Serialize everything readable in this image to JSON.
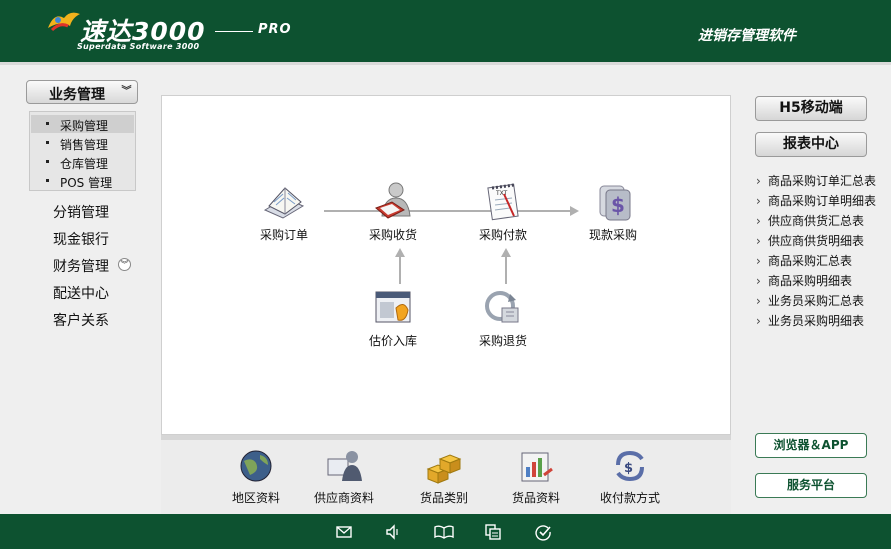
{
  "header": {
    "brand_title": "速达3000",
    "brand_sub": "Superdata Software 3000",
    "brand_pro": "PRO",
    "right_title": "进销存管理软件"
  },
  "sidebar": {
    "menu_label": "业务管理",
    "submenu": [
      {
        "label": "采购管理",
        "selected": true
      },
      {
        "label": "销售管理",
        "selected": false
      },
      {
        "label": "仓库管理",
        "selected": false
      },
      {
        "label": "POS 管理",
        "selected": false
      }
    ],
    "items": [
      "分销管理",
      "现金银行",
      "财务管理",
      "配送中心",
      "客户关系"
    ]
  },
  "flow": {
    "nodes": [
      "采购订单",
      "采购收货",
      "采购付款",
      "现款采购",
      "估价入库",
      "采购退货"
    ]
  },
  "tools": [
    "地区资料",
    "供应商资料",
    "货品类别",
    "货品资料",
    "收付款方式"
  ],
  "right": {
    "h5_label": "H5移动端",
    "report_label": "报表中心",
    "reports": [
      "商品采购订单汇总表",
      "商品采购订单明细表",
      "供应商供货汇总表",
      "供应商供货明细表",
      "商品采购汇总表",
      "商品采购明细表",
      "业务员采购汇总表",
      "业务员采购明细表"
    ],
    "browser_label": "浏览器＆APP",
    "service_label": "服务平台"
  },
  "colors": {
    "brand_green": "#0d5230",
    "panel_bg": "#ffffff",
    "page_bg": "#efefef"
  },
  "footer_icons": [
    "mail-icon",
    "speaker-icon",
    "book-icon",
    "copy-icon",
    "check-icon"
  ]
}
